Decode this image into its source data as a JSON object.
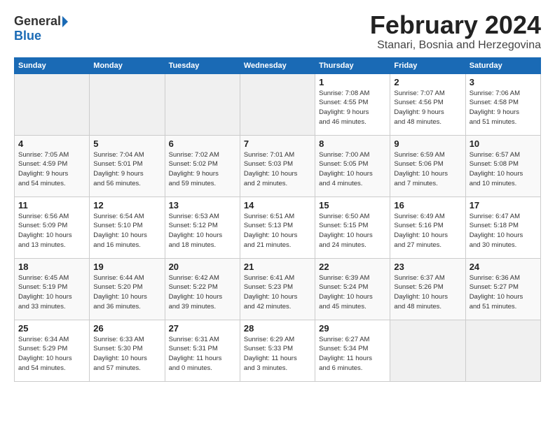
{
  "logo": {
    "general": "General",
    "blue": "Blue"
  },
  "header": {
    "month_year": "February 2024",
    "location": "Stanari, Bosnia and Herzegovina"
  },
  "weekdays": [
    "Sunday",
    "Monday",
    "Tuesday",
    "Wednesday",
    "Thursday",
    "Friday",
    "Saturday"
  ],
  "weeks": [
    [
      {
        "day": "",
        "info": ""
      },
      {
        "day": "",
        "info": ""
      },
      {
        "day": "",
        "info": ""
      },
      {
        "day": "",
        "info": ""
      },
      {
        "day": "1",
        "info": "Sunrise: 7:08 AM\nSunset: 4:55 PM\nDaylight: 9 hours\nand 46 minutes."
      },
      {
        "day": "2",
        "info": "Sunrise: 7:07 AM\nSunset: 4:56 PM\nDaylight: 9 hours\nand 48 minutes."
      },
      {
        "day": "3",
        "info": "Sunrise: 7:06 AM\nSunset: 4:58 PM\nDaylight: 9 hours\nand 51 minutes."
      }
    ],
    [
      {
        "day": "4",
        "info": "Sunrise: 7:05 AM\nSunset: 4:59 PM\nDaylight: 9 hours\nand 54 minutes."
      },
      {
        "day": "5",
        "info": "Sunrise: 7:04 AM\nSunset: 5:01 PM\nDaylight: 9 hours\nand 56 minutes."
      },
      {
        "day": "6",
        "info": "Sunrise: 7:02 AM\nSunset: 5:02 PM\nDaylight: 9 hours\nand 59 minutes."
      },
      {
        "day": "7",
        "info": "Sunrise: 7:01 AM\nSunset: 5:03 PM\nDaylight: 10 hours\nand 2 minutes."
      },
      {
        "day": "8",
        "info": "Sunrise: 7:00 AM\nSunset: 5:05 PM\nDaylight: 10 hours\nand 4 minutes."
      },
      {
        "day": "9",
        "info": "Sunrise: 6:59 AM\nSunset: 5:06 PM\nDaylight: 10 hours\nand 7 minutes."
      },
      {
        "day": "10",
        "info": "Sunrise: 6:57 AM\nSunset: 5:08 PM\nDaylight: 10 hours\nand 10 minutes."
      }
    ],
    [
      {
        "day": "11",
        "info": "Sunrise: 6:56 AM\nSunset: 5:09 PM\nDaylight: 10 hours\nand 13 minutes."
      },
      {
        "day": "12",
        "info": "Sunrise: 6:54 AM\nSunset: 5:10 PM\nDaylight: 10 hours\nand 16 minutes."
      },
      {
        "day": "13",
        "info": "Sunrise: 6:53 AM\nSunset: 5:12 PM\nDaylight: 10 hours\nand 18 minutes."
      },
      {
        "day": "14",
        "info": "Sunrise: 6:51 AM\nSunset: 5:13 PM\nDaylight: 10 hours\nand 21 minutes."
      },
      {
        "day": "15",
        "info": "Sunrise: 6:50 AM\nSunset: 5:15 PM\nDaylight: 10 hours\nand 24 minutes."
      },
      {
        "day": "16",
        "info": "Sunrise: 6:49 AM\nSunset: 5:16 PM\nDaylight: 10 hours\nand 27 minutes."
      },
      {
        "day": "17",
        "info": "Sunrise: 6:47 AM\nSunset: 5:18 PM\nDaylight: 10 hours\nand 30 minutes."
      }
    ],
    [
      {
        "day": "18",
        "info": "Sunrise: 6:45 AM\nSunset: 5:19 PM\nDaylight: 10 hours\nand 33 minutes."
      },
      {
        "day": "19",
        "info": "Sunrise: 6:44 AM\nSunset: 5:20 PM\nDaylight: 10 hours\nand 36 minutes."
      },
      {
        "day": "20",
        "info": "Sunrise: 6:42 AM\nSunset: 5:22 PM\nDaylight: 10 hours\nand 39 minutes."
      },
      {
        "day": "21",
        "info": "Sunrise: 6:41 AM\nSunset: 5:23 PM\nDaylight: 10 hours\nand 42 minutes."
      },
      {
        "day": "22",
        "info": "Sunrise: 6:39 AM\nSunset: 5:24 PM\nDaylight: 10 hours\nand 45 minutes."
      },
      {
        "day": "23",
        "info": "Sunrise: 6:37 AM\nSunset: 5:26 PM\nDaylight: 10 hours\nand 48 minutes."
      },
      {
        "day": "24",
        "info": "Sunrise: 6:36 AM\nSunset: 5:27 PM\nDaylight: 10 hours\nand 51 minutes."
      }
    ],
    [
      {
        "day": "25",
        "info": "Sunrise: 6:34 AM\nSunset: 5:29 PM\nDaylight: 10 hours\nand 54 minutes."
      },
      {
        "day": "26",
        "info": "Sunrise: 6:33 AM\nSunset: 5:30 PM\nDaylight: 10 hours\nand 57 minutes."
      },
      {
        "day": "27",
        "info": "Sunrise: 6:31 AM\nSunset: 5:31 PM\nDaylight: 11 hours\nand 0 minutes."
      },
      {
        "day": "28",
        "info": "Sunrise: 6:29 AM\nSunset: 5:33 PM\nDaylight: 11 hours\nand 3 minutes."
      },
      {
        "day": "29",
        "info": "Sunrise: 6:27 AM\nSunset: 5:34 PM\nDaylight: 11 hours\nand 6 minutes."
      },
      {
        "day": "",
        "info": ""
      },
      {
        "day": "",
        "info": ""
      }
    ]
  ]
}
